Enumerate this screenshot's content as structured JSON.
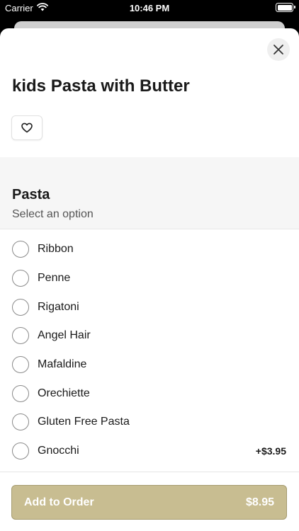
{
  "status_bar": {
    "carrier": "Carrier",
    "time": "10:46 PM"
  },
  "item": {
    "title": "kids Pasta with Butter"
  },
  "section": {
    "title": "Pasta",
    "subtitle": "Select an option"
  },
  "options": [
    {
      "label": "Ribbon",
      "price": ""
    },
    {
      "label": "Penne",
      "price": ""
    },
    {
      "label": "Rigatoni",
      "price": ""
    },
    {
      "label": "Angel Hair",
      "price": ""
    },
    {
      "label": "Mafaldine",
      "price": ""
    },
    {
      "label": "Orechiette",
      "price": ""
    },
    {
      "label": "Gluten Free Pasta",
      "price": ""
    },
    {
      "label": "Gnocchi",
      "price": "+$3.95"
    }
  ],
  "footer": {
    "add_label": "Add to Order",
    "total": "$8.95"
  },
  "colors": {
    "accent": "#c8bd91",
    "section_bg": "#f6f6f6"
  },
  "icons": {
    "close": "close-icon",
    "favorite": "heart-icon",
    "wifi": "wifi-icon",
    "battery": "battery-icon"
  }
}
